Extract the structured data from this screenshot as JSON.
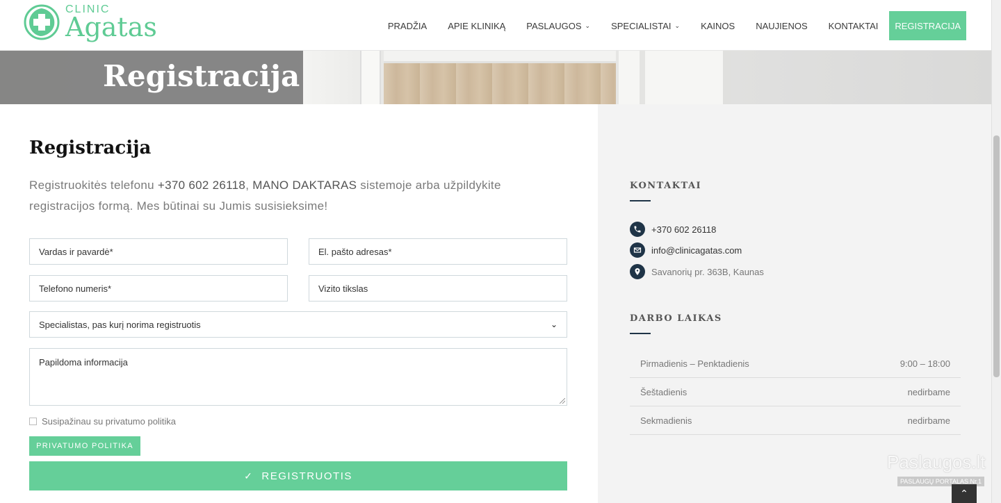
{
  "brand": {
    "small": "CLINIC",
    "name": "Agatas",
    "color": "#5fcb94"
  },
  "nav": {
    "items": [
      {
        "label": "PRADŽIA",
        "dropdown": false
      },
      {
        "label": "APIE KLINIKĄ",
        "dropdown": false
      },
      {
        "label": "PASLAUGOS",
        "dropdown": true
      },
      {
        "label": "SPECIALISTAI",
        "dropdown": true
      },
      {
        "label": "KAINOS",
        "dropdown": false
      },
      {
        "label": "NAUJIENOS",
        "dropdown": false
      },
      {
        "label": "KONTAKTAI",
        "dropdown": false
      }
    ],
    "cta": "REGISTRACIJA"
  },
  "hero": {
    "title": "Registracija"
  },
  "main": {
    "title": "Registracija",
    "intro_pre": "Registruokitės telefonu ",
    "intro_phone": "+370 602 26118",
    "intro_mid": ", ",
    "intro_system": "MANO DAKTARAS",
    "intro_post": " sistemoje arba užpildykite registracijos formą. Mes būtinai su Jumis susisieksime!"
  },
  "form": {
    "name_placeholder": "Vardas ir pavardė*",
    "email_placeholder": "El. pašto adresas*",
    "phone_placeholder": "Telefono numeris*",
    "purpose_placeholder": "Vizito tikslas",
    "specialist_selected": "Specialistas, pas kurį norima registruotis",
    "info_placeholder": "Papildoma informacija",
    "consent_label": "Susipažinau su privatumo politika",
    "privacy_button": "PRIVATUMO POLITIKA",
    "submit_button": "REGISTRUOTIS"
  },
  "sidebar": {
    "contacts_heading": "KONTAKTAI",
    "phone": "+370 602 26118",
    "email": "info@clinicagatas.com",
    "address": "Savanorių pr. 363B, Kaunas",
    "hours_heading": "DARBO LAIKAS",
    "hours": [
      {
        "day": "Pirmadienis – Penktadienis",
        "time": "9:00 – 18:00"
      },
      {
        "day": "Šeštadienis",
        "time": "nedirbame"
      },
      {
        "day": "Sekmadienis",
        "time": "nedirbame"
      }
    ]
  },
  "watermark": {
    "big": "Paslaugos.lt",
    "small": "PASLAUGŲ PORTALAS  Nr.1"
  },
  "colors": {
    "accent": "#65cf99",
    "navy": "#1f3447",
    "sidebar_bg": "#f3f3f3"
  }
}
